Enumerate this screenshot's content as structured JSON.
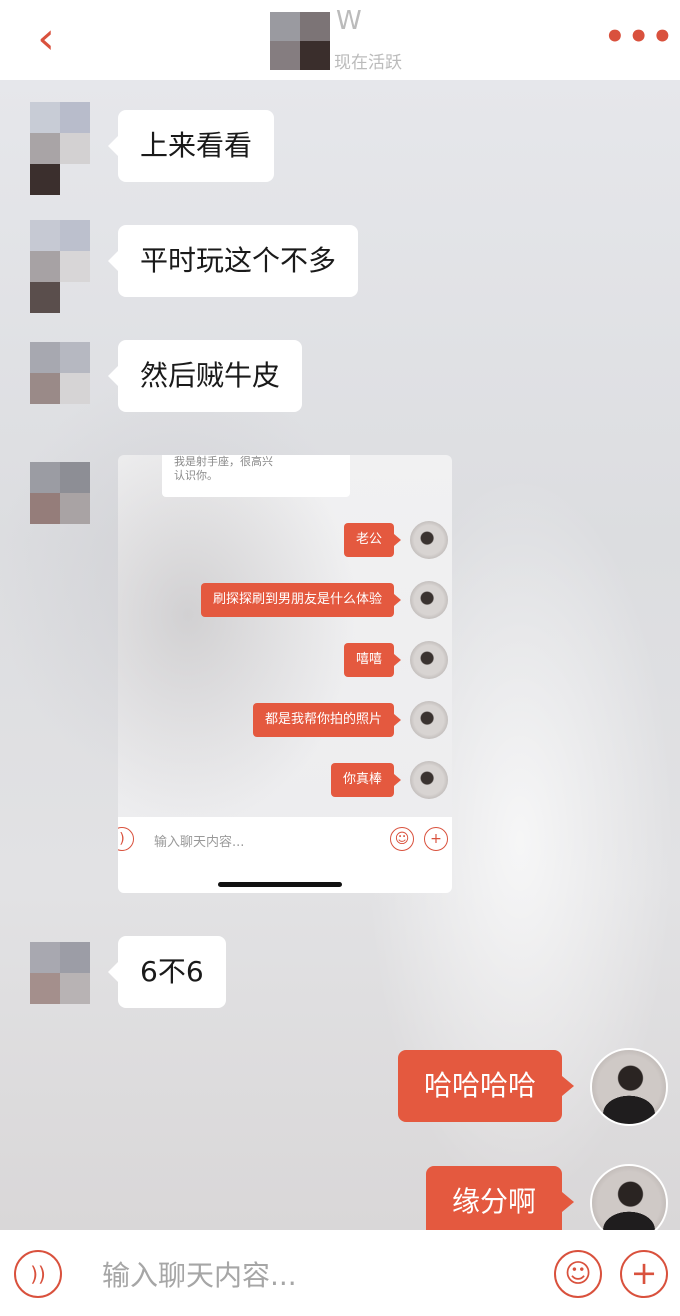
{
  "header": {
    "back_icon": "chevron-left-icon",
    "name": "W",
    "status": "现在活跃",
    "more_icon": "more-dots-icon",
    "accent": "#d9513d"
  },
  "messages": [
    {
      "side": "incoming",
      "text": "上来看看"
    },
    {
      "side": "incoming",
      "text": "平时玩这个不多"
    },
    {
      "side": "incoming",
      "text": "然后贼牛皮"
    },
    {
      "side": "incoming",
      "type": "image"
    },
    {
      "side": "incoming",
      "text": "6不6"
    },
    {
      "side": "outgoing",
      "text": "哈哈哈哈"
    },
    {
      "side": "outgoing",
      "text": "缘分啊"
    }
  ],
  "screenshot": {
    "card_line1": "我是射手座，很高兴",
    "card_line2": "认识你。",
    "messages": [
      "老公",
      "刷探探刷到男朋友是什么体验",
      "嘻嘻",
      "都是我帮你拍的照片",
      "你真棒"
    ],
    "input_placeholder": "输入聊天内容..."
  },
  "input": {
    "placeholder": "输入聊天内容...",
    "voice_icon": "voice-icon",
    "emoji_icon": "emoji-icon",
    "plus_icon": "plus-icon"
  },
  "colors": {
    "accent": "#d9513d",
    "outgoing_bubble": "#e4593f",
    "incoming_bubble": "#ffffff"
  }
}
